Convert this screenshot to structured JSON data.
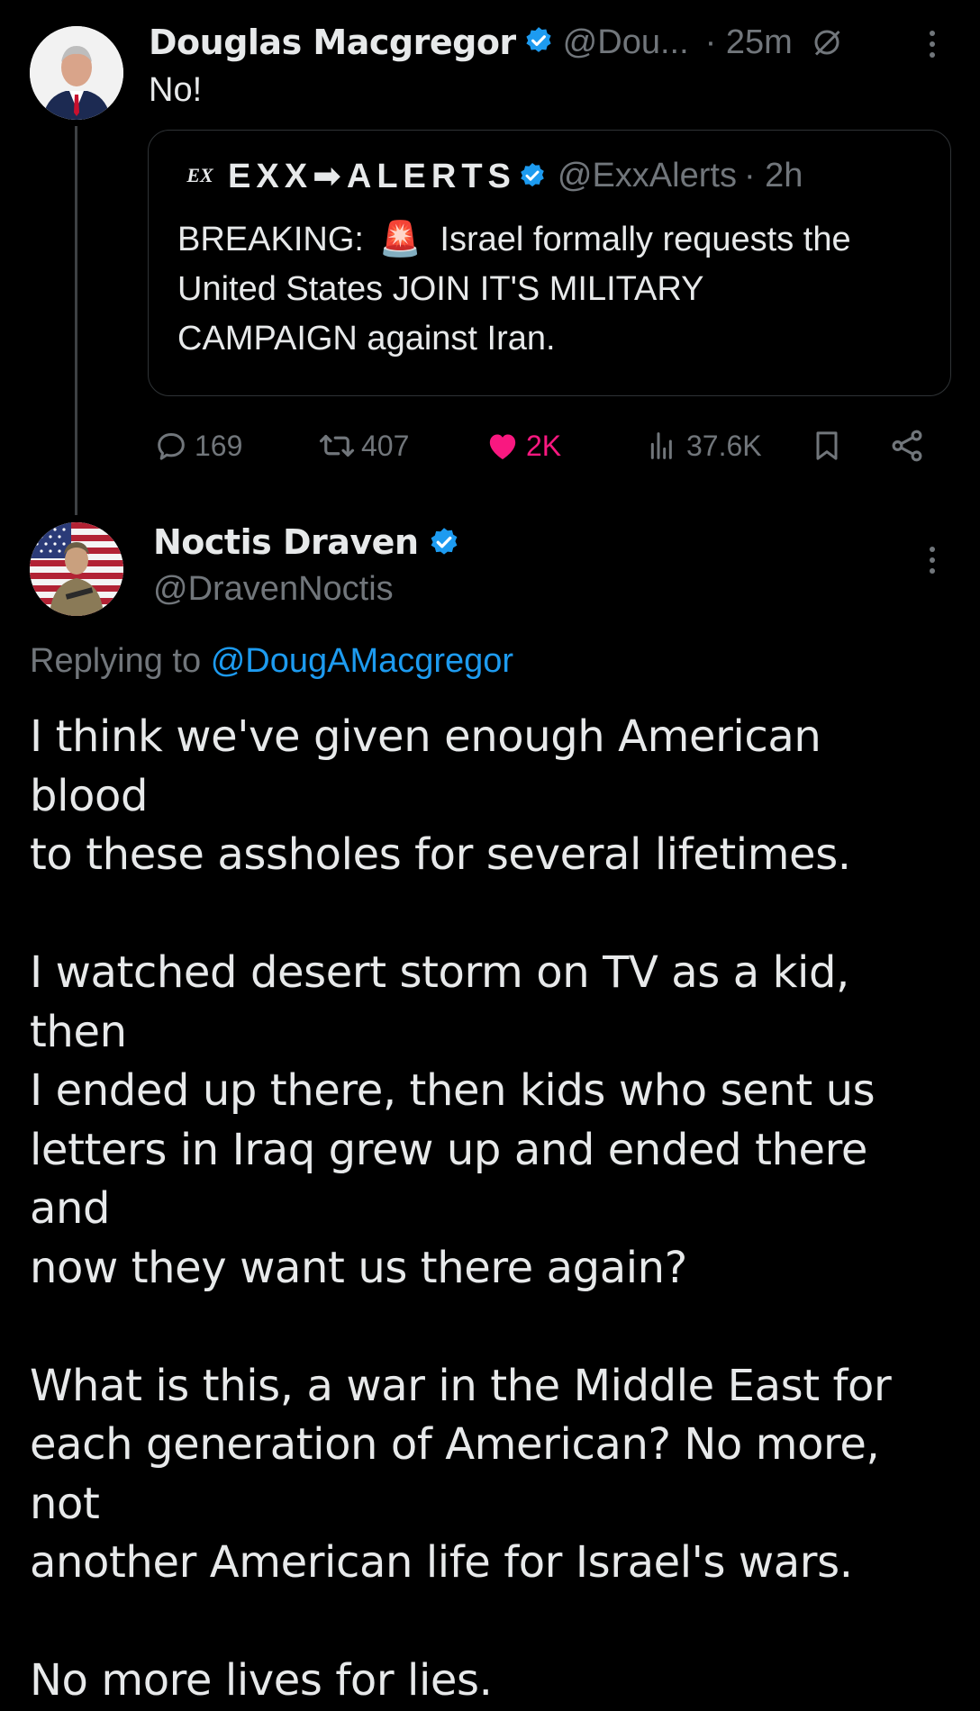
{
  "tweet": {
    "author_name": "Douglas Macgregor",
    "author_handle": "@Dou...",
    "time": "· 25m",
    "text": "No!",
    "quote": {
      "logo_text": "EX",
      "author_name": "EXX➡ALERTS",
      "author_handle": "@ExxAlerts",
      "time": "· 2h",
      "text_prefix": "BREAKING:",
      "emoji": "🚨",
      "text_line1_rest": "Israel formally requests the",
      "text_line2": "United States JOIN IT'S MILITARY",
      "text_line3": "CAMPAIGN against Iran."
    },
    "stats": {
      "replies": "169",
      "reposts": "407",
      "likes": "2K",
      "views": "37.6K"
    }
  },
  "reply": {
    "author_name": "Noctis Draven",
    "author_handle": "@DravenNoctis",
    "replying_to_label": "Replying to",
    "replying_to_handle": "@DougAMacgregor",
    "body": "I think we've given enough American blood\nto these assholes for several lifetimes.\n\nI watched desert storm on TV as a kid, then\nI ended up there, then kids who sent us\nletters in Iraq grew up and ended there and\nnow they want us there again?\n\nWhat is this, a war in the Middle East for\neach generation of American? No more, not\nanother American life for Israel's wars.\n\nNo more lives for lies."
  },
  "colors": {
    "background": "#000000",
    "text": "#e7e9ea",
    "muted": "#71767b",
    "link": "#1d9bf0",
    "like": "#f91880",
    "verified": "#1d9bf0"
  },
  "icons": [
    "verified-badge-icon",
    "grok-icon",
    "more-icon",
    "reply-icon",
    "repost-icon",
    "like-icon",
    "views-icon",
    "bookmark-icon",
    "share-icon"
  ]
}
